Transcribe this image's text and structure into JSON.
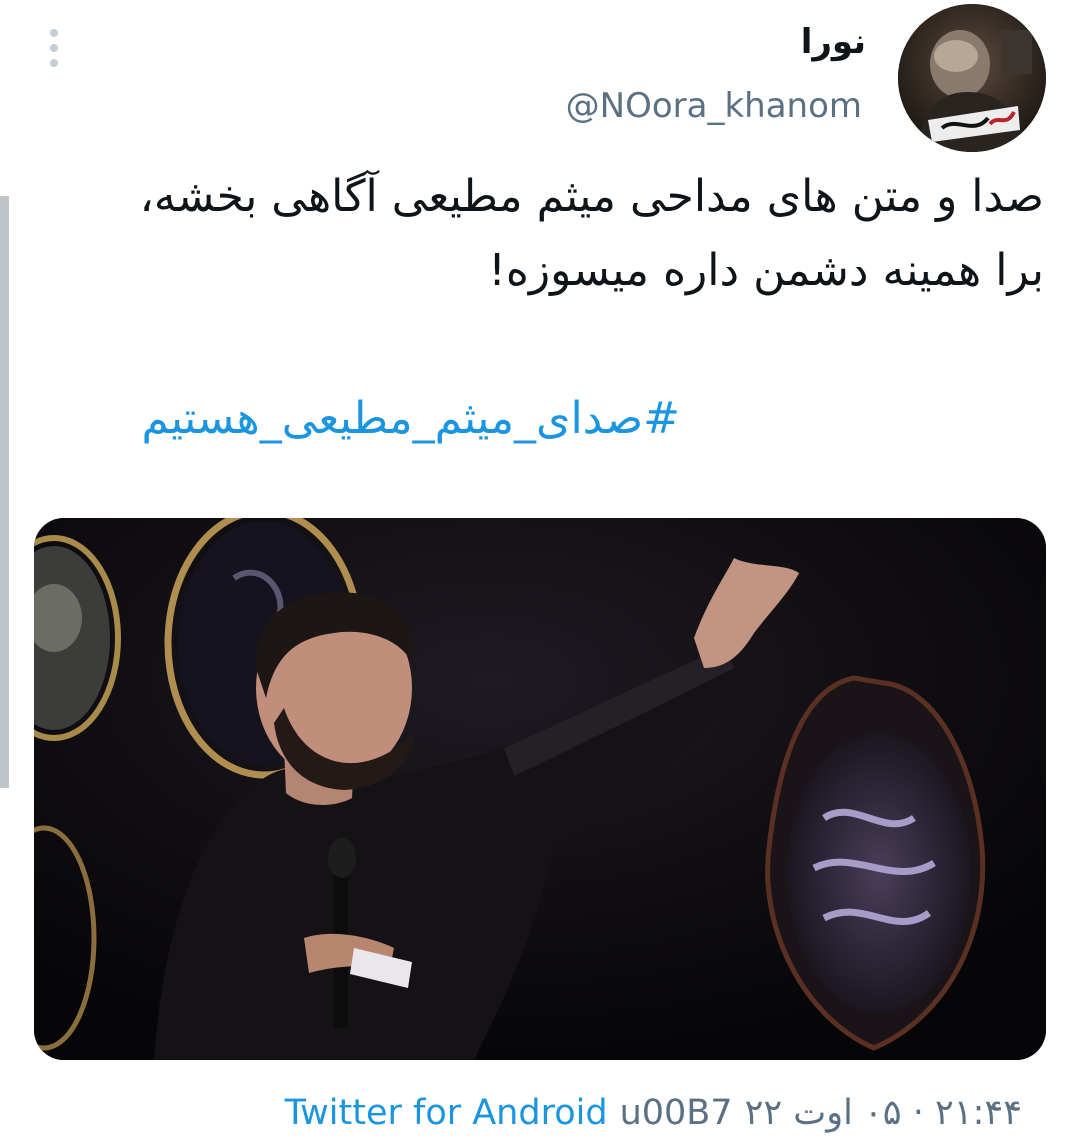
{
  "tweet": {
    "display_name": "نورا",
    "username": "@NOora_khanom",
    "text": "صدا و متن های مداحی میثم مطیعی آگاهی بخشه، برا همینه دشمن داره میسوزه!",
    "hashtag": "#صدای_میثم_مطیعی_هستیم",
    "source": "Twitter for Android",
    "separator": "u00B7",
    "timestamp": "۲۱:۴۴ · ۰۵ اوت ۲۲"
  },
  "avatar": {
    "overlay_text": "لبیک یا حسین"
  },
  "icons": {
    "more": "more-vertical-icon"
  },
  "colors": {
    "link": "#1b95e0",
    "secondary_text": "#5b7083",
    "primary_text": "#0f1419"
  }
}
